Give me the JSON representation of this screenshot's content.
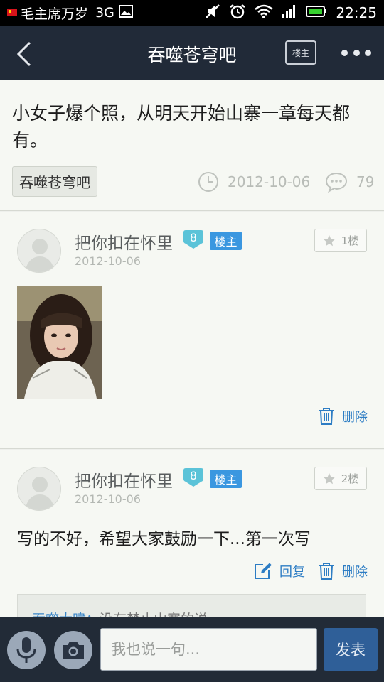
{
  "status_bar": {
    "carrier": "毛主席万岁",
    "network": "3G",
    "time": "22:25",
    "icons": [
      "flag-icon",
      "image-icon",
      "mute-icon",
      "alarm-icon",
      "wifi-icon",
      "signal-icon",
      "battery-icon"
    ]
  },
  "top_bar": {
    "title": "吞噬苍穹吧",
    "louzhu_button": "楼主",
    "icons": [
      "back-arrow-icon",
      "more-dots-icon"
    ]
  },
  "thread": {
    "title": "小女子爆个照，从明天开始山寨一章每天都有。",
    "forum_tag": "吞噬苍穹吧",
    "date": "2012-10-06",
    "reply_count": "79"
  },
  "posts": [
    {
      "username": "把你扣在怀里",
      "level": "8",
      "badge": "楼主",
      "date": "2012-10-06",
      "floor": "1楼",
      "has_image": true,
      "delete_label": "删除"
    },
    {
      "username": "把你扣在怀里",
      "level": "8",
      "badge": "楼主",
      "date": "2012-10-06",
      "floor": "2楼",
      "text": "写的不好，希望大家鼓励一下...第一次写",
      "reply_label": "回复",
      "delete_label": "删除",
      "sub_reply": {
        "author": "吞噬大暐：",
        "text": "没有禁止山寨的说"
      }
    }
  ],
  "bottom_bar": {
    "input_placeholder": "我也说一句...",
    "send_label": "发表"
  },
  "colors": {
    "top_bar_bg": "#212a38",
    "accent_blue": "#2d7dc4",
    "louzhu_badge": "#3a97e0",
    "level_badge": "#5bc3d8",
    "send_button": "#2f5f98"
  }
}
